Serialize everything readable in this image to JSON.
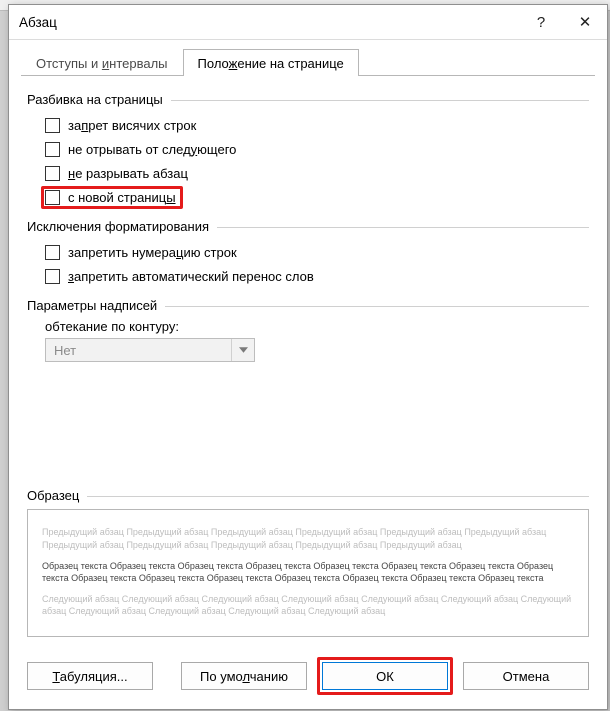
{
  "dialog": {
    "title": "Абзац",
    "help_tooltip": "?",
    "close_tooltip": "✕"
  },
  "tabs": {
    "indent": {
      "pre": "Отступы и ",
      "und": "и",
      "post": "нтервалы"
    },
    "page": {
      "pre": "Поло",
      "und": "ж",
      "post": "ение на странице"
    }
  },
  "group_pagination": "Разбивка на страницы",
  "opt_widow": {
    "pre": "за",
    "und": "п",
    "post": "рет висячих строк"
  },
  "opt_keepnext": {
    "pre": "не отрывать от след",
    "und": "у",
    "post": "ющего"
  },
  "opt_keeptog": {
    "pre": "",
    "und": "н",
    "post": "е разрывать абзац"
  },
  "opt_newpage": {
    "pre": "с новой страниц",
    "und": "ы",
    "post": ""
  },
  "group_exceptions": "Исключения форматирования",
  "opt_nolinenum": {
    "pre": "запретить нумера",
    "und": "ц",
    "post": "ию строк"
  },
  "opt_nohyph": {
    "pre": "",
    "und": "з",
    "post": "апретить автоматический перенос слов"
  },
  "group_textbox": "Параметры надписей",
  "textbox_label": {
    "pre": "о",
    "und": "б",
    "post": "текание по контуру:"
  },
  "textbox_value": "Нет",
  "preview_label": "Образец",
  "preview": {
    "prev": "Предыдущий абзац Предыдущий абзац Предыдущий абзац Предыдущий абзац Предыдущий абзац Предыдущий абзац Предыдущий абзац Предыдущий абзац Предыдущий абзац Предыдущий абзац Предыдущий абзац",
    "sample": "Образец текста Образец текста Образец текста Образец текста Образец текста Образец текста Образец текста Образец текста Образец текста Образец текста Образец текста Образец текста Образец текста Образец текста Образец текста",
    "next": "Следующий абзац Следующий абзац Следующий абзац Следующий абзац Следующий абзац Следующий абзац Следующий абзац Следующий абзац Следующий абзац Следующий абзац Следующий абзац"
  },
  "buttons": {
    "tabs": {
      "pre": "",
      "und": "Т",
      "post": "абуляция..."
    },
    "default": {
      "pre": "По умо",
      "und": "л",
      "post": "чанию"
    },
    "ok": "ОК",
    "cancel": "Отмена"
  }
}
